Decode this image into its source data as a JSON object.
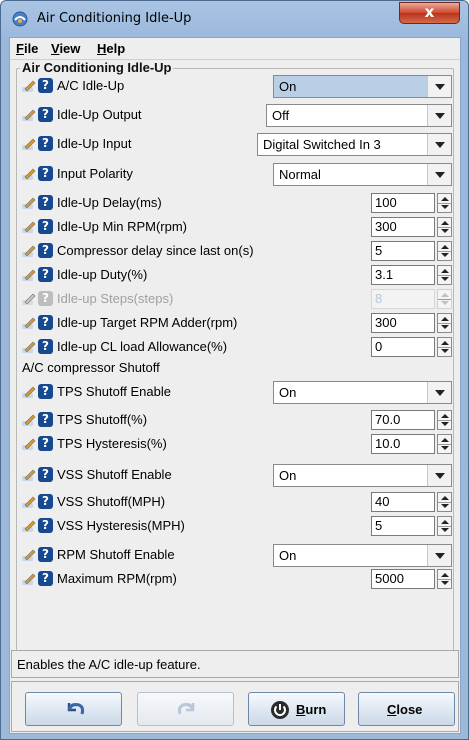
{
  "window": {
    "title": "Air Conditioning Idle-Up",
    "close_glyph": "x"
  },
  "menu": [
    {
      "label": "File",
      "mnemonic": "F",
      "rest": "ile"
    },
    {
      "label": "View",
      "mnemonic": "V",
      "rest": "iew"
    },
    {
      "label": "Help",
      "mnemonic": "H",
      "rest": "elp"
    }
  ],
  "group_title": "Air Conditioning Idle-Up",
  "fields": [
    {
      "label": "A/C Idle-Up",
      "type": "combo",
      "value": "On",
      "highlight": true
    },
    {
      "label": "Idle-Up Output",
      "type": "combo",
      "value": "Off"
    },
    {
      "label": "Idle-Up Input",
      "type": "combo",
      "value": "Digital Switched In 3"
    },
    {
      "label": "Input Polarity",
      "type": "combo",
      "value": "Normal"
    },
    {
      "label": "Idle-Up Delay(ms)",
      "type": "spinner",
      "value": "100"
    },
    {
      "label": "Idle-Up Min RPM(rpm)",
      "type": "spinner",
      "value": "300"
    },
    {
      "label": "Compressor delay since last on(s)",
      "type": "spinner",
      "value": "5"
    },
    {
      "label": "Idle-up Duty(%)",
      "type": "spinner",
      "value": "3.1"
    },
    {
      "label": "Idle-up Steps(steps)",
      "type": "spinner",
      "value": "8",
      "disabled": true
    },
    {
      "label": "Idle-up Target RPM Adder(rpm)",
      "type": "spinner",
      "value": "300"
    },
    {
      "label": "Idle-up CL load Allowance(%)",
      "type": "spinner",
      "value": "0"
    }
  ],
  "section2_label": "A/C compressor Shutoff",
  "fields2": [
    {
      "label": "TPS Shutoff Enable",
      "type": "combo",
      "value": "On"
    },
    {
      "label": "TPS Shutoff(%)",
      "type": "spinner",
      "value": "70.0"
    },
    {
      "label": "TPS Hysteresis(%)",
      "type": "spinner",
      "value": "10.0"
    },
    {
      "label": "VSS Shutoff Enable",
      "type": "combo",
      "value": "On"
    },
    {
      "label": "VSS Shutoff(MPH)",
      "type": "spinner",
      "value": "40"
    },
    {
      "label": "VSS Hysteresis(MPH)",
      "type": "spinner",
      "value": "5"
    },
    {
      "label": "RPM Shutoff Enable",
      "type": "combo",
      "value": "On"
    },
    {
      "label": "Maximum RPM(rpm)",
      "type": "spinner",
      "value": "5000"
    }
  ],
  "status_text": "Enables the A/C idle-up feature.",
  "buttons": {
    "undo": {
      "icon": "undo-icon"
    },
    "redo": {
      "icon": "redo-icon",
      "disabled": true
    },
    "burn": {
      "label": "Burn",
      "mnemonic": "B",
      "rest": "urn",
      "icon": "power-icon"
    },
    "close": {
      "label": "Close",
      "mnemonic": "C",
      "rest": "lose"
    }
  },
  "icons": {
    "pencil": "pencil-icon",
    "help": "help-icon",
    "help_glyph": "?"
  }
}
